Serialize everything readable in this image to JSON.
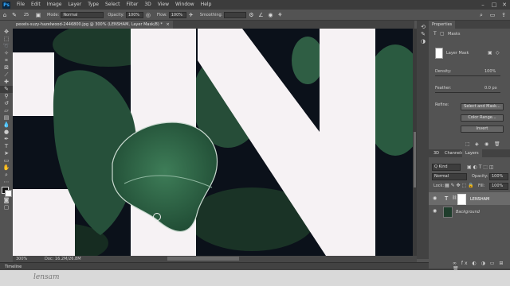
{
  "app": {
    "logo": "Ps"
  },
  "menu": [
    "File",
    "Edit",
    "Image",
    "Layer",
    "Type",
    "Select",
    "Filter",
    "3D",
    "View",
    "Window",
    "Help"
  ],
  "options": {
    "size": "25",
    "mode_label": "Mode:",
    "mode_value": "Normal",
    "opacity_label": "Opacity:",
    "opacity_value": "100%",
    "flow_label": "Flow:",
    "flow_value": "100%",
    "smoothing_label": "Smoothing:"
  },
  "document": {
    "tab_title": "pexels-suzy-hazelwood-2446800.jpg @ 300% (LENSHAM, Layer Mask/8) *",
    "zoom": "300%",
    "doc_info": "Doc: 16.2M/26.8M"
  },
  "timeline": {
    "label": "Timeline"
  },
  "strip": {
    "brand": "lensam"
  },
  "properties": {
    "tabs": [
      "Properties"
    ],
    "section": "Masks",
    "mask_label": "Layer Mask",
    "density_label": "Density:",
    "density_value": "100%",
    "feather_label": "Feather:",
    "feather_value": "0.0 px",
    "refine_label": "Refine:",
    "select_mask_button": "Select and Mask...",
    "color_range_button": "Color Range...",
    "invert_button": "Invert"
  },
  "layers": {
    "tabs": [
      "3D",
      "Channels",
      "Layers"
    ],
    "kind_filter": "Q Kind",
    "blend_mode": "Normal",
    "opacity_label": "Opacity:",
    "opacity_value": "100%",
    "lock_label": "Lock:",
    "fill_label": "Fill:",
    "fill_value": "100%",
    "rows": [
      {
        "name": "LENSHAM"
      },
      {
        "name": "Background"
      }
    ]
  },
  "colors": {
    "accent": "#31a8ff",
    "canvas_white": "#f6f2f4",
    "leaf": "#2f6b4a"
  }
}
